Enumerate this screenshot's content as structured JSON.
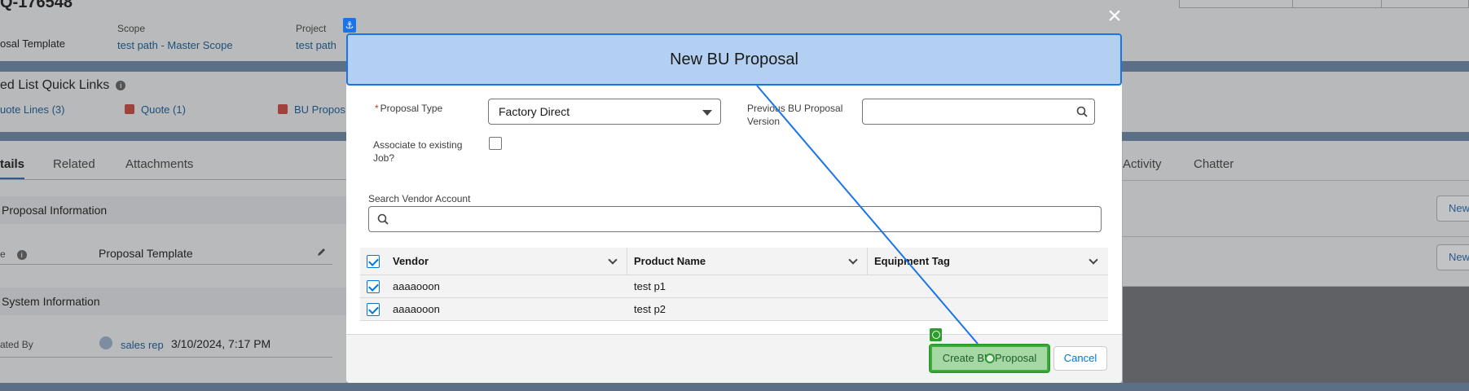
{
  "background": {
    "record_title": "Q-176548",
    "fields": [
      {
        "label": "",
        "value": "osal Template"
      },
      {
        "label": "Scope",
        "value": "test path - Master Scope"
      },
      {
        "label": "Project",
        "value": "test path"
      }
    ],
    "quick_links": {
      "title": "ed List Quick Links",
      "links": [
        "uote Lines (3)",
        "Quote (1)",
        "BU Propos"
      ]
    },
    "tabs": {
      "active": "tails",
      "items": [
        "Related",
        "Attachments"
      ]
    },
    "right_tabs": [
      "Activity",
      "Chatter"
    ],
    "sections": {
      "proposal_info": "Proposal Information",
      "system_info": "System Information"
    },
    "rows": {
      "template_label": "e",
      "template_value": "Proposal Template",
      "created_label": "ated By",
      "created_user": "sales rep",
      "created_date": "3/10/2024, 7:17 PM"
    },
    "right_buttons": [
      "New",
      "New"
    ]
  },
  "modal": {
    "title": "New BU Proposal",
    "close_label": "×",
    "proposal_type": {
      "label": "Proposal Type",
      "required_mark": "*",
      "value": "Factory Direct"
    },
    "previous_version": {
      "label": "Previous BU Proposal Version",
      "value": ""
    },
    "associate_job": {
      "label": "Associate to existing Job?",
      "checked": false
    },
    "vendor_search": {
      "label": "Search Vendor Account",
      "value": ""
    },
    "table": {
      "columns": [
        "Vendor",
        "Product Name",
        "Equipment Tag"
      ],
      "rows": [
        {
          "vendor": "aaaaooon",
          "product": "test p1",
          "tag": "",
          "selected": true
        },
        {
          "vendor": "aaaaooon",
          "product": "test p2",
          "tag": "",
          "selected": true
        }
      ]
    },
    "buttons": {
      "create": "Create BU Proposal",
      "cancel": "Cancel"
    }
  },
  "colors": {
    "brand": "#0176d3",
    "highlight": "#1a73e8",
    "target": "#2e9b2e"
  }
}
